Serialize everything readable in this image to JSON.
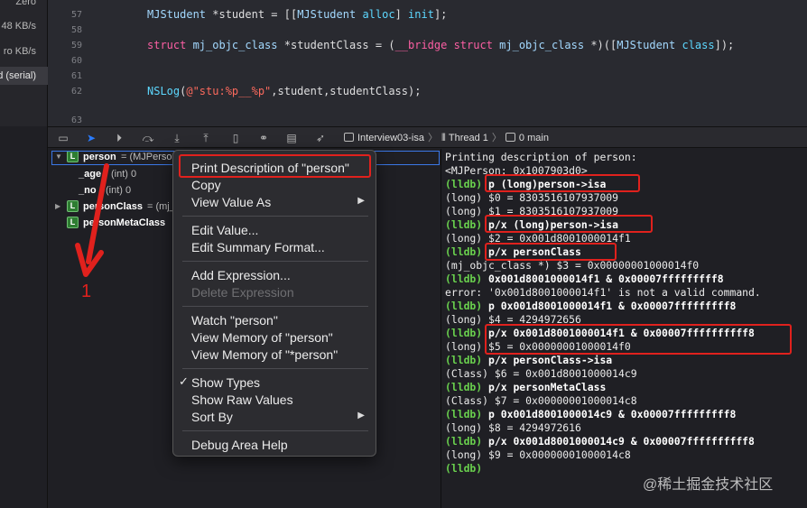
{
  "navigator": {
    "rows": [
      "Zero",
      "48 KB/s",
      "ro KB/s",
      "d (serial)"
    ]
  },
  "editor": {
    "lines": [
      {
        "num": "57",
        "text": ""
      },
      {
        "num": "58",
        "text": ""
      },
      {
        "num": "59",
        "text": ""
      },
      {
        "num": "60",
        "text": ""
      },
      {
        "num": "61",
        "text": ""
      },
      {
        "num": "62",
        "text": ""
      },
      {
        "num": "63",
        "text": ""
      }
    ],
    "line57": {
      "a": "MJStudent",
      "b": " *student = [[",
      "c": "MJStudent",
      "d": " alloc",
      "e": "] ",
      "f": "init",
      "g": "];"
    },
    "line59": {
      "a": "struct",
      "b": " mj_objc_class",
      "c": " *studentClass = (",
      "d": "__bridge",
      "e": " struct",
      "f": " mj_objc_class",
      "g": " *)([",
      "h": "MJStudent",
      "i": " class",
      "j": "]);"
    },
    "line62": {
      "a": "NSLog",
      "b": "(",
      "c": "@\"stu:%p__%p\"",
      "d": ",student,studentClass);"
    }
  },
  "toolbar": {
    "crumb_target": "Interview03-isa",
    "crumb_thread": "Thread 1",
    "crumb_frame": "0 main"
  },
  "variables": [
    {
      "name": "person",
      "value": "= (MJPerso",
      "badge": "L",
      "expanded": true
    },
    {
      "name": "_age",
      "value": "(int) 0"
    },
    {
      "name": "_no",
      "value": "(int) 0"
    },
    {
      "name": "personClass",
      "value": "= (mj_",
      "badge": "L",
      "expandable": true
    },
    {
      "name": "personMetaClass",
      "value": "",
      "badge": "L"
    }
  ],
  "context_menu": {
    "print_description": "Print Description of \"person\"",
    "copy": "Copy",
    "view_value_as": "View Value As",
    "edit_value": "Edit Value...",
    "edit_summary": "Edit Summary Format...",
    "add_expression": "Add Expression...",
    "delete_expression": "Delete Expression",
    "watch": "Watch \"person\"",
    "view_memory": "View Memory of \"person\"",
    "view_memory_ptr": "View Memory of \"*person\"",
    "show_types": "Show Types",
    "show_raw": "Show Raw Values",
    "sort_by": "Sort By",
    "debug_help": "Debug Area Help"
  },
  "console": {
    "prompt": "(lldb)",
    "lines": [
      {
        "type": "out",
        "text": "Printing description of person:"
      },
      {
        "type": "out",
        "text": "<MJPerson: 0x1007903d0>"
      },
      {
        "type": "cmd",
        "text": " p (long)person->isa"
      },
      {
        "type": "out",
        "text": "(long) $0 = 8303516107937009"
      },
      {
        "type": "out",
        "text": "(long) $1 = 8303516107937009"
      },
      {
        "type": "cmd",
        "text": " p/x (long)person->isa"
      },
      {
        "type": "out",
        "text": "(long) $2 = 0x001d8001000014f1"
      },
      {
        "type": "cmd",
        "text": " p/x personClass"
      },
      {
        "type": "out",
        "text": "(mj_objc_class *) $3 = 0x00000001000014f0"
      },
      {
        "type": "cmd",
        "text": " 0x001d8001000014f1 & 0x00007fffffffff8"
      },
      {
        "type": "out",
        "text": "error: '0x001d8001000014f1' is not a valid command."
      },
      {
        "type": "cmd",
        "text": " p 0x001d8001000014f1 & 0x00007fffffffff8"
      },
      {
        "type": "out",
        "text": "(long) $4 = 4294972656"
      },
      {
        "type": "cmd",
        "text": " p/x 0x001d8001000014f1 & 0x00007ffffffffff8"
      },
      {
        "type": "out",
        "text": "(long) $5 = 0x00000001000014f0"
      },
      {
        "type": "cmd",
        "text": " p/x personClass->isa"
      },
      {
        "type": "out",
        "text": "(Class) $6 = 0x001d8001000014c9"
      },
      {
        "type": "cmd",
        "text": " p/x personMetaClass"
      },
      {
        "type": "out",
        "text": "(Class) $7 = 0x00000001000014c8"
      },
      {
        "type": "cmd",
        "text": " p 0x001d8001000014c9 & 0x00007fffffffff8"
      },
      {
        "type": "out",
        "text": "(long) $8 = 4294972616"
      },
      {
        "type": "cmd",
        "text": " p/x 0x001d8001000014c9 & 0x00007ffffffffff8"
      },
      {
        "type": "out",
        "text": "(long) $9 = 0x00000001000014c8"
      },
      {
        "type": "cmd",
        "text": ""
      }
    ]
  },
  "annotation": {
    "number": "1"
  },
  "watermark": "@稀土掘金技术社区",
  "colors": {
    "accent_blue": "#2a7cff",
    "highlight_red": "#e0211d",
    "lldb_green": "#6ad24e"
  }
}
